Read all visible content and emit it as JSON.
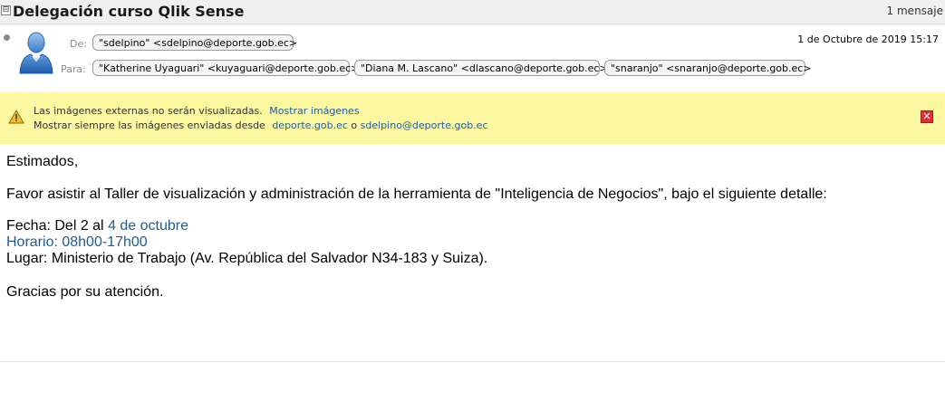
{
  "header": {
    "collapse_symbol": "⊟",
    "subject": "Delegación curso Qlik Sense",
    "message_count": "1 mensaje"
  },
  "message": {
    "from_label": "De:",
    "from": "\"sdelpino\" <sdelpino@deporte.gob.ec>",
    "to_label": "Para:",
    "to": [
      "\"Katherine Uyaguari\" <kuyaguari@deporte.gob.ec>",
      "\"Diana M. Lascano\" <dlascano@deporte.gob.ec>",
      "\"snaranjo\" <snaranjo@deporte.gob.ec>"
    ],
    "date": "1 de Octubre de 2019 15:17"
  },
  "banner": {
    "line1_text": "Las imágenes externas no serán visualizadas.",
    "line1_link": "Mostrar imágenes",
    "line2_text": "Mostrar siempre las imágenes enviadas desde",
    "line2_link1": "deporte.gob.ec",
    "line2_or": "o",
    "line2_link2": "sdelpino@deporte.gob.ec",
    "close_symbol": "✕"
  },
  "body": {
    "greeting": "Estimados,",
    "intro": "Favor asistir al Taller de visualización y administración de la herramienta de \"Inteligencia de Negocios\", bajo el siguiente detalle:",
    "fecha_label": "Fecha: Del 2 al",
    "fecha_link": "4 de octubre",
    "horario": "Horario: 08h00-17h00",
    "lugar": "Lugar: Ministerio de Trabajo (Av. República del Salvador N34-183 y Suiza).",
    "closing": "Gracias por su atención."
  },
  "colors": {
    "banner_bg": "#fbf7a0",
    "link": "#1e5fa3",
    "close_red": "#e03030"
  },
  "icons": [
    "collapse-icon",
    "unread-dot-icon",
    "user-avatar-icon",
    "warning-icon",
    "close-icon"
  ]
}
